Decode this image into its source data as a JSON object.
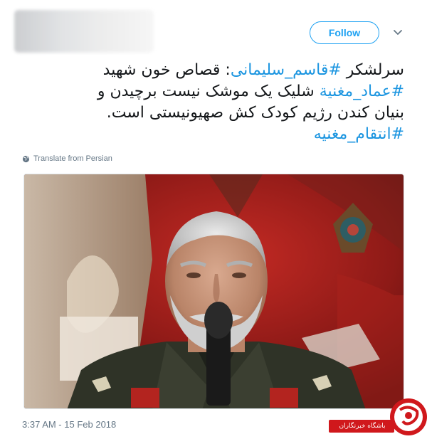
{
  "header": {
    "follow_label": "Follow",
    "more_icon": "chevron-down-icon"
  },
  "tweet": {
    "text": {
      "line1_prefix": "سرلشکر ",
      "hashtag_soleimani": "#قاسم_سلیمانی",
      "line1_suffix": ": قصاص خون شهید",
      "hashtag_imad": "#عماد_مغنیة",
      "line2_suffix": " شلیک یک موشک نیست برچیدن و",
      "line3": "بنیان کندن رژیم کودک کش صهیونیستی است.",
      "hashtag_revenge": "#انتقام_مغنیه"
    },
    "translate_label": "Translate from Persian",
    "translate_icon": "globe-icon",
    "timestamp": "3:37 AM - 15 Feb 2018"
  },
  "watermark": {
    "label": "باشگاه خبرنگاران"
  },
  "colors": {
    "accent": "#1da1f2",
    "hashtag": "#1b95e0",
    "muted": "#657786",
    "watermark_red": "#d0181c"
  }
}
